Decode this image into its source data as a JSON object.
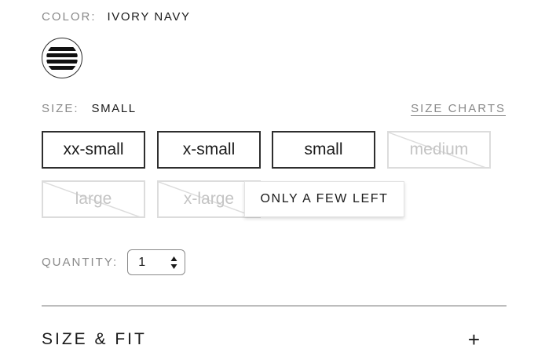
{
  "color": {
    "label": "COLOR:",
    "value": "IVORY NAVY",
    "swatch_icon": "striped-swatch-icon",
    "swatch_colors": [
      "#ffffff",
      "#111111"
    ]
  },
  "size": {
    "label": "SIZE:",
    "value": "SMALL",
    "charts_link": "SIZE CHARTS",
    "options": [
      {
        "label": "xx-small",
        "available": true
      },
      {
        "label": "x-small",
        "available": true
      },
      {
        "label": "small",
        "available": true,
        "selected": true
      },
      {
        "label": "medium",
        "available": false
      },
      {
        "label": "large",
        "available": false
      },
      {
        "label": "x-large",
        "available": false
      }
    ]
  },
  "tooltip": {
    "text": "ONLY A FEW LEFT"
  },
  "quantity": {
    "label": "QUANTITY:",
    "value": "1"
  },
  "size_fit": {
    "title": "SIZE & FIT",
    "expand_icon": "plus-icon",
    "expand_glyph": "+"
  },
  "colors": {
    "text": "#1a1a1a",
    "muted": "#8a8a8a",
    "border": "#2e2e2e",
    "unavailable": "#c4c4c4",
    "divider": "#bdbdbd"
  }
}
